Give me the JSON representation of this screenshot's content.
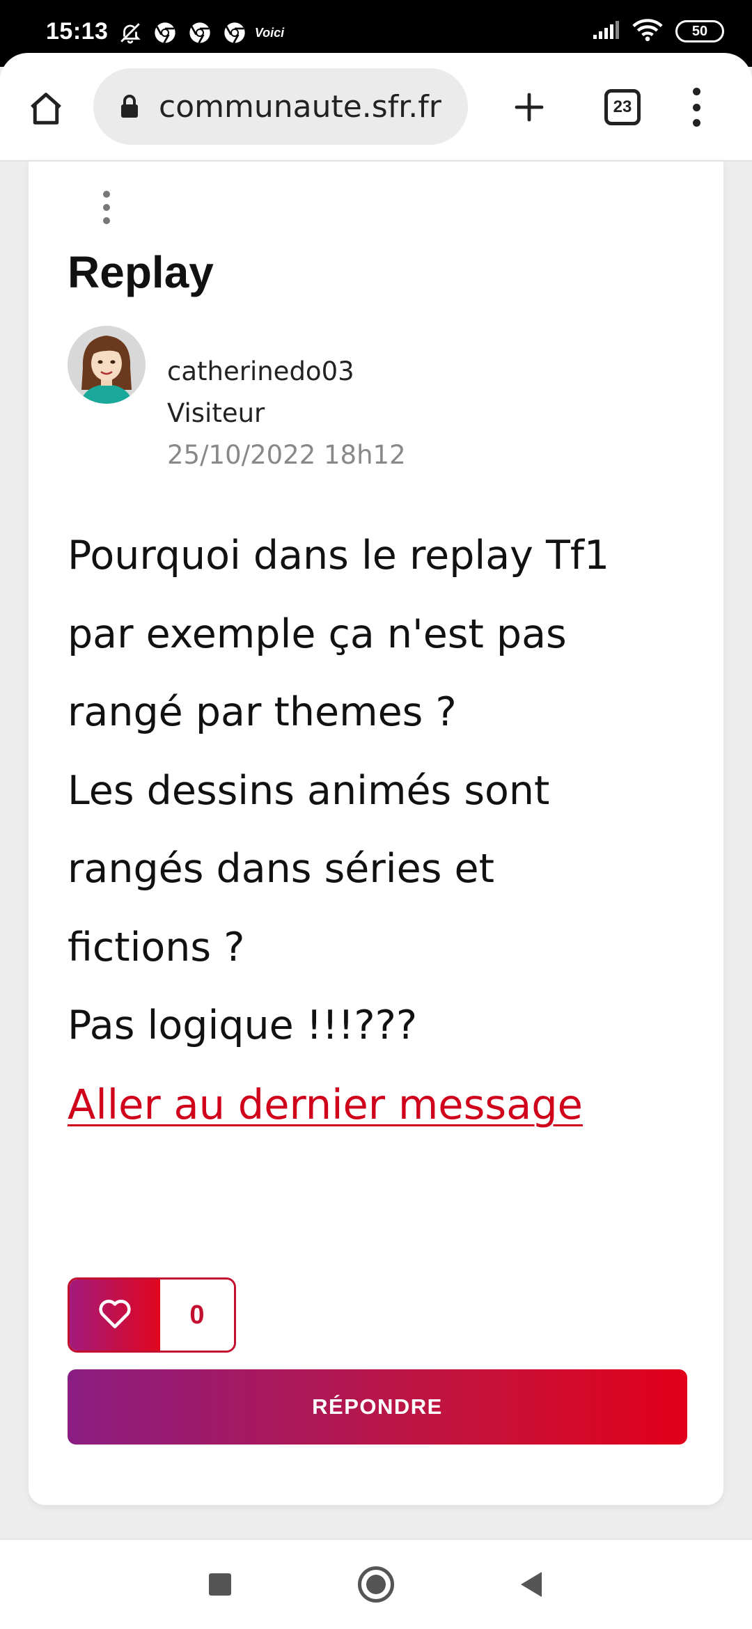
{
  "status_bar": {
    "time": "15:13",
    "notification_icons": [
      "bell-off-icon",
      "chrome-icon",
      "chrome-icon",
      "chrome-icon"
    ],
    "voici_label": "Voici",
    "battery": "50"
  },
  "browser": {
    "url": "communaute.sfr.fr",
    "tab_count": "23"
  },
  "post": {
    "title": "Replay",
    "author": "catherinedo03",
    "rank": "Visiteur",
    "date": "25/10/2022 18h12",
    "body_lines": [
      "Pourquoi dans le replay Tf1",
      "par exemple ça n'est pas",
      "rangé par themes ?",
      "Les dessins animés sont",
      "rangés dans séries et",
      "fictions ?",
      "Pas logique !!!???"
    ],
    "last_message_link": "Aller au dernier message",
    "like_count": "0",
    "reply_label": "RÉPONDRE"
  },
  "colors": {
    "accent_red": "#e2001a",
    "accent_purple": "#8a1d82",
    "link_red": "#d0021b"
  }
}
